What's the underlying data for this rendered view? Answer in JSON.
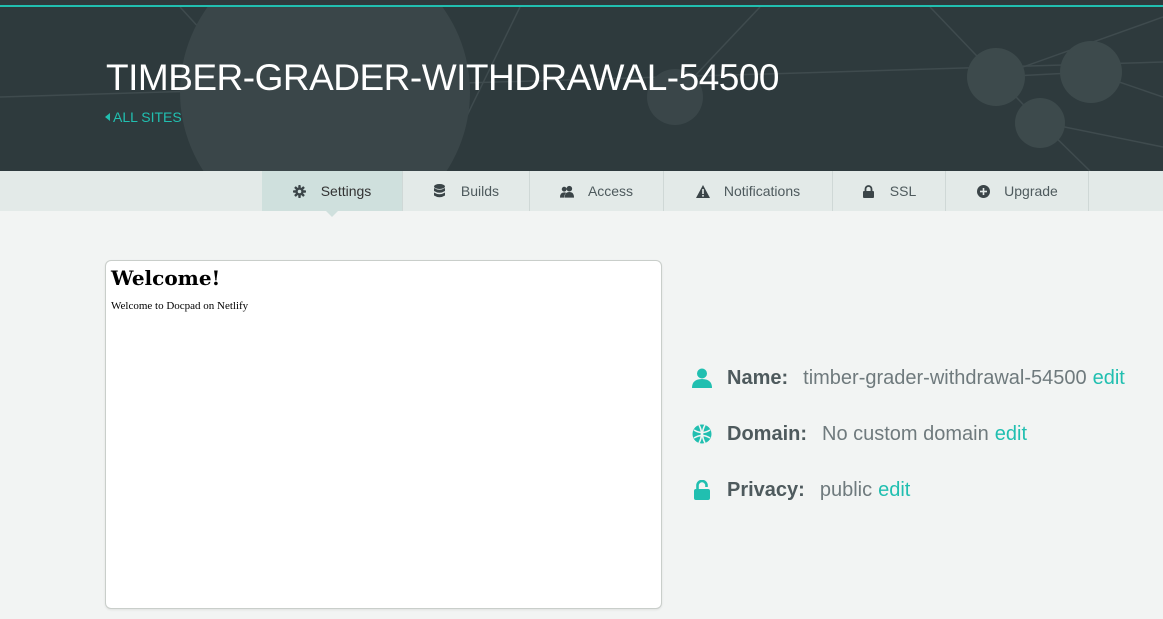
{
  "header": {
    "site_title": "TIMBER-GRADER-WITHDRAWAL-54500",
    "all_sites_label": "ALL SITES"
  },
  "tabs": [
    {
      "label": "Settings",
      "icon": "gear-icon",
      "active": true
    },
    {
      "label": "Builds",
      "icon": "database-icon",
      "active": false
    },
    {
      "label": "Access",
      "icon": "users-icon",
      "active": false
    },
    {
      "label": "Notifications",
      "icon": "warning-icon",
      "active": false
    },
    {
      "label": "SSL",
      "icon": "lock-icon",
      "active": false
    },
    {
      "label": "Upgrade",
      "icon": "plus-circle-icon",
      "active": false
    }
  ],
  "preview": {
    "heading": "Welcome!",
    "text": "Welcome to Docpad on Netlify"
  },
  "info": {
    "name": {
      "label": "Name:",
      "value": "timber-grader-withdrawal-54500",
      "edit": "edit"
    },
    "domain": {
      "label": "Domain:",
      "value": "No custom domain",
      "edit": "edit"
    },
    "privacy": {
      "label": "Privacy:",
      "value": "public",
      "edit": "edit"
    }
  },
  "colors": {
    "accent": "#21bfb0",
    "header_bg": "#2e3a3d",
    "page_bg": "#f2f4f3",
    "tabbar_bg": "#e3eae8"
  }
}
